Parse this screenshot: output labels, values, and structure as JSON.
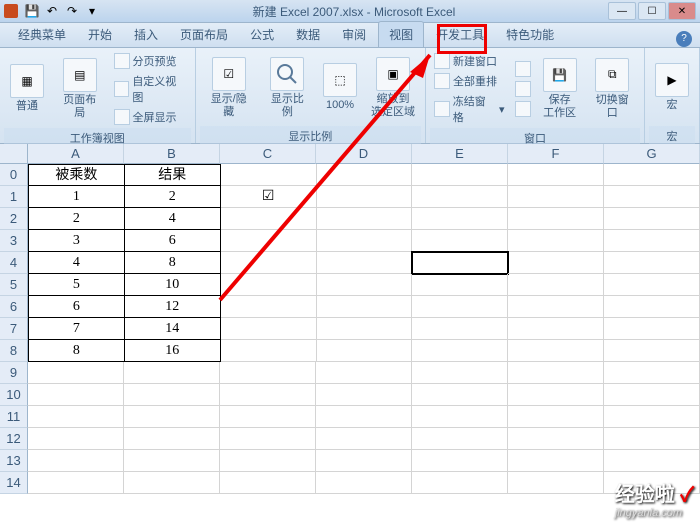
{
  "title": "新建 Excel 2007.xlsx - Microsoft Excel",
  "tabs": [
    "经典菜单",
    "开始",
    "插入",
    "页面布局",
    "公式",
    "数据",
    "审阅",
    "视图",
    "开发工具",
    "特色功能"
  ],
  "active_tab": "视图",
  "ribbon": {
    "g1_label": "工作簿视图",
    "g1_normal": "普通",
    "g1_pagelayout": "页面布局",
    "g1_pagebreak": "分页预览",
    "g1_custom": "自定义视图",
    "g1_fullscreen": "全屏显示",
    "g2_label": "显示比例",
    "g2_showhide": "显示/隐藏",
    "g2_zoom": "显示比例",
    "g2_100": "100%",
    "g2_zoomsel": "缩放到\n选定区域",
    "g3_label": "窗口",
    "g3_new": "新建窗口",
    "g3_arrange": "全部重排",
    "g3_freeze": "冻结窗格",
    "g3_save": "保存\n工作区",
    "g3_switch": "切换窗口",
    "g4_label": "宏",
    "g4_macro": "宏"
  },
  "cols": [
    "A",
    "B",
    "C",
    "D",
    "E",
    "F",
    "G"
  ],
  "table": {
    "header": [
      "被乘数",
      "结果"
    ],
    "rows": [
      [
        "1",
        "2"
      ],
      [
        "2",
        "4"
      ],
      [
        "3",
        "6"
      ],
      [
        "4",
        "8"
      ],
      [
        "5",
        "10"
      ],
      [
        "6",
        "12"
      ],
      [
        "7",
        "14"
      ],
      [
        "8",
        "16"
      ]
    ]
  },
  "checkbox_char": "☑",
  "watermark": {
    "text": "经验啦",
    "url": "jingyanla.com"
  }
}
